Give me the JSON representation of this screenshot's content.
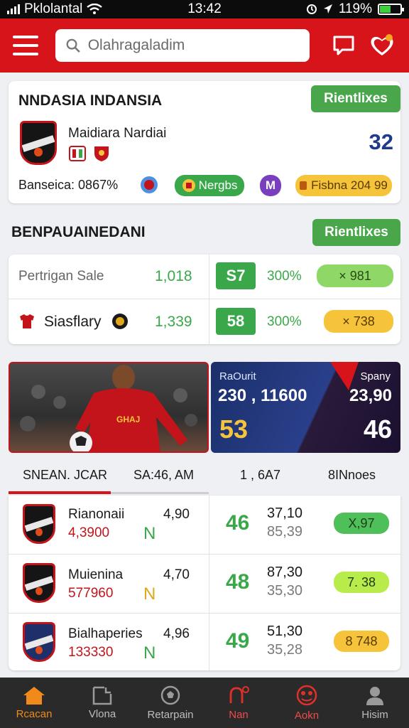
{
  "status": {
    "carrier": "Pklolantal",
    "time": "13:42",
    "battery": "119%",
    "battery_level": 0.55
  },
  "header": {
    "search_placeholder": "Olahragaladim"
  },
  "match_card": {
    "title": "NNDASIA INDANSIA",
    "button": "Rientlixes",
    "team_name": "Maidiara Nardiai",
    "score": "32",
    "stat_label": "Banseica: 0867%",
    "pill_green": "Nergbs",
    "pill_yellow": "Fisbna 204 99",
    "pill_purple_glyph": "M"
  },
  "section2": {
    "title": "BENPAUAINEDANI",
    "button": "Rientlixes",
    "rows": [
      {
        "label": "Pertrigan Sale",
        "value": "1,018",
        "box": "S7",
        "pct": "300%",
        "pill": "× 981",
        "pill_color": "#8fd867"
      },
      {
        "label": "Siasflary",
        "value": "1,339",
        "box": "58",
        "pct": "300%",
        "pill": "× 738",
        "pill_color": "#f5c43a"
      }
    ]
  },
  "feature": {
    "stat_left_label": "RaOurit",
    "stat_left_value": "230 , 11600",
    "stat_left_big": "53",
    "stat_right_label": "Spany",
    "stat_right_value": "23,90",
    "stat_right_big": "46",
    "jersey_text": "GHAJ"
  },
  "table": {
    "headers": [
      "SNEAN. JCAR",
      "SA:46, AM",
      "1 , 6A7",
      "8INnoes"
    ],
    "rows": [
      {
        "name": "Rianonaii",
        "sub": "4,3900",
        "odd": "4,90",
        "letter": "N",
        "letter_color": "#3aa84a",
        "big": "46",
        "top": "37,10",
        "bottom": "85,39",
        "pill": "Χ,97",
        "pill_color": "#4fbf5a"
      },
      {
        "name": "Muienina",
        "sub": "577960",
        "odd": "4,70",
        "letter": "N",
        "letter_color": "#e2a81a",
        "big": "48",
        "top": "87,30",
        "bottom": "35,30",
        "pill": "7. 38",
        "pill_color": "#b8ec4a"
      },
      {
        "name": "Bialhaperies",
        "sub": "133330",
        "odd": "4,96",
        "letter": "N",
        "letter_color": "#3aa84a",
        "big": "49",
        "top": "51,30",
        "bottom": "35,28",
        "pill": "8 748",
        "pill_color": "#f5c43a"
      }
    ]
  },
  "nav": [
    {
      "label": "Rcacan"
    },
    {
      "label": "Vlona"
    },
    {
      "label": "Retarpain"
    },
    {
      "label": "Nan"
    },
    {
      "label": "Aokn"
    },
    {
      "label": "Hisim"
    }
  ]
}
